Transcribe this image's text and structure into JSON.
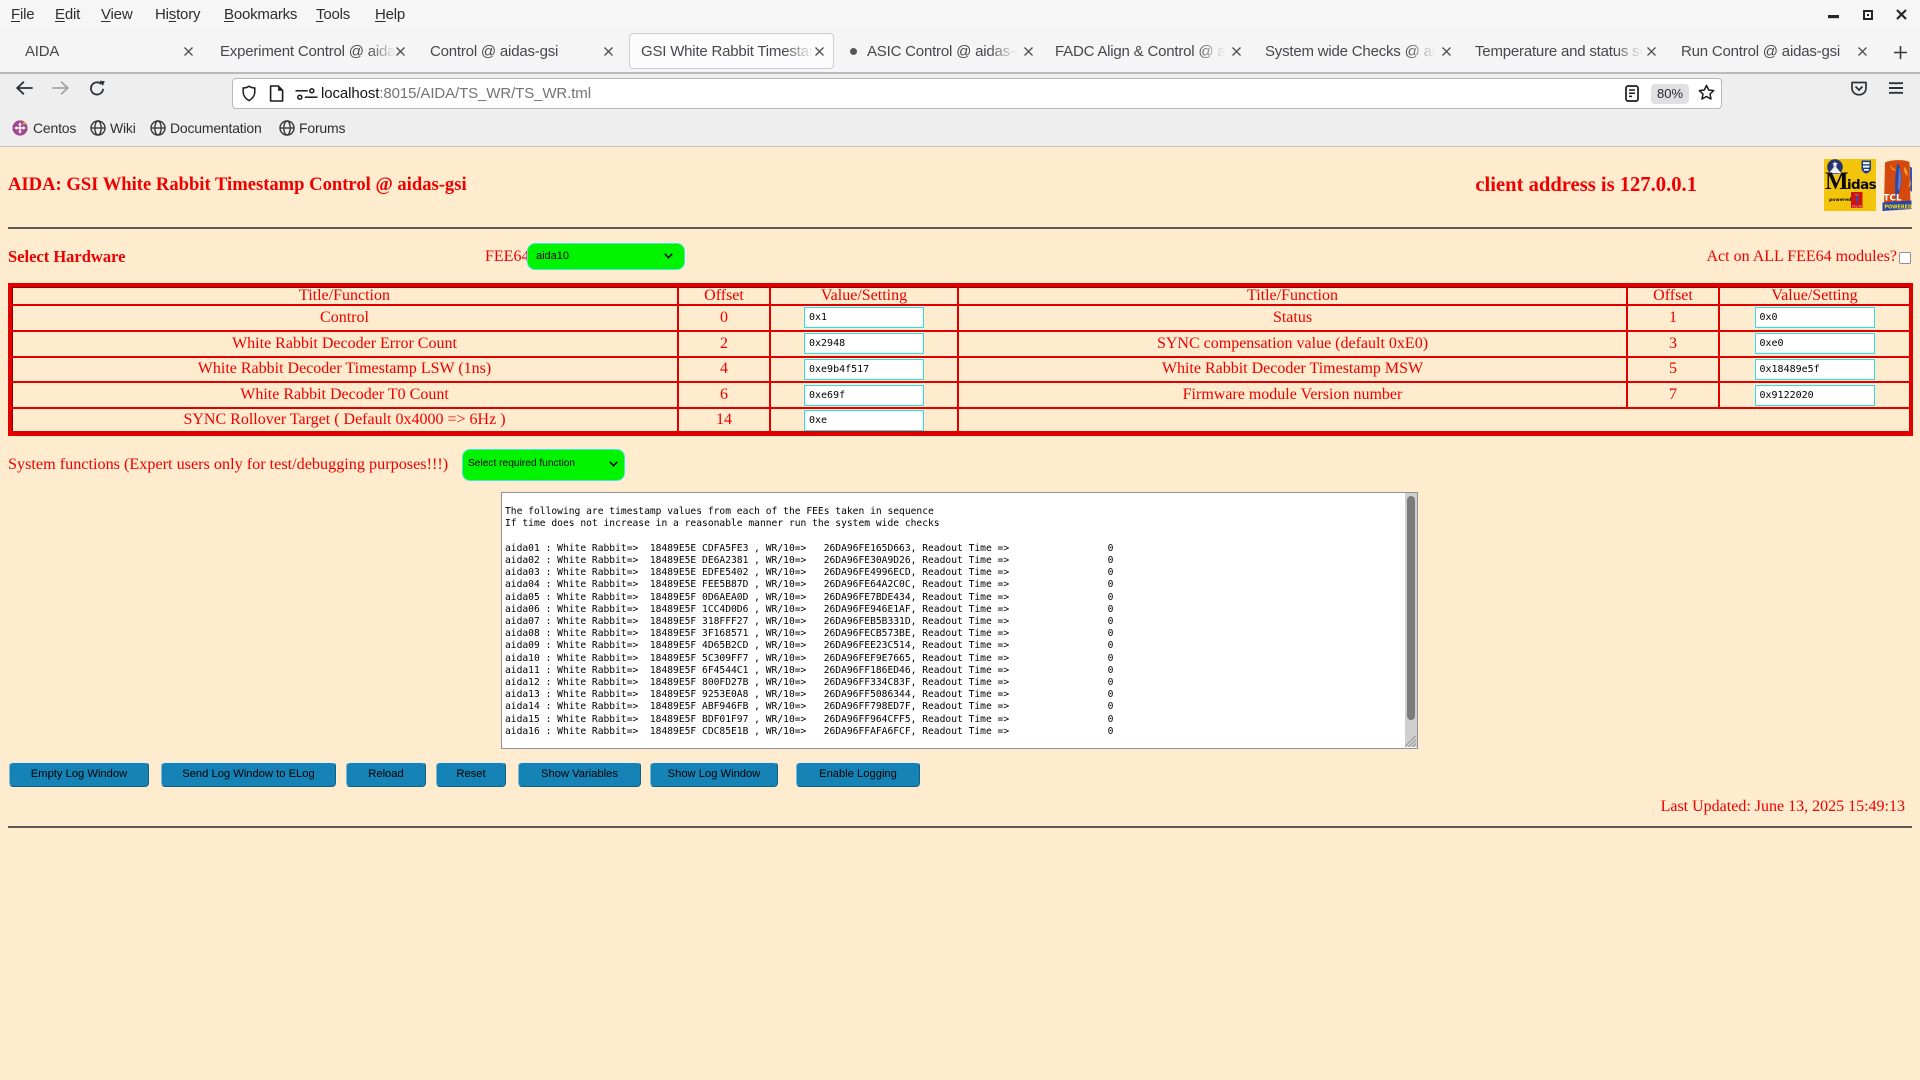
{
  "browser": {
    "menu": {
      "items": [
        "File",
        "Edit",
        "View",
        "History",
        "Bookmarks",
        "Tools",
        "Help"
      ]
    },
    "window_controls": [
      "minimize",
      "restore",
      "close"
    ],
    "tabs": [
      {
        "label": "AIDA",
        "active": false
      },
      {
        "label": "Experiment Control @ aidas",
        "active": false
      },
      {
        "label": "Control @ aidas-gsi",
        "active": false
      },
      {
        "label": "GSI White Rabbit Timestam",
        "active": true
      },
      {
        "label": "ASIC Control @ aidas-g",
        "active": false,
        "indicator_dot": true
      },
      {
        "label": "FADC Align & Control @ ai",
        "active": false
      },
      {
        "label": "System wide Checks @ aid",
        "active": false
      },
      {
        "label": "Temperature and status sc",
        "active": false
      },
      {
        "label": "Run Control @ aidas-gsi",
        "active": false
      }
    ],
    "new_tab_button": "+",
    "urlbar": {
      "host": "localhost",
      "rest": ":8015/AIDA/TS_WR/TS_WR.tml",
      "zoom_level": "80%"
    },
    "bookmarks": [
      {
        "label": "Centos",
        "icon": "centos"
      },
      {
        "label": "Wiki",
        "icon": "globe"
      },
      {
        "label": "Documentation",
        "icon": "globe"
      },
      {
        "label": "Forums",
        "icon": "globe"
      }
    ]
  },
  "page": {
    "title": "AIDA: GSI White Rabbit Timestamp Control @ aidas-gsi",
    "client_address": "client address is 127.0.0.1",
    "select_hardware_label": "Select Hardware",
    "fee64_label": "FEE64",
    "fee64_selected": "aida10",
    "act_on_all_label": "Act on ALL FEE64 modules?",
    "act_on_all_checked": false,
    "system_functions_label": "System functions (Expert users only for test/debugging purposes!!!)",
    "system_functions_selected": "Select required function",
    "last_updated": "Last Updated: June 13, 2025 15:49:13",
    "colors": {
      "background": "#FFEBCD",
      "text_red": "#ee0000",
      "table_border_red": "#e00000",
      "select_green": "#00ef00",
      "input_border_cyan": "#2ae0e8",
      "button_blue": "#1583b5"
    }
  },
  "table": {
    "headers": [
      "Title/Function",
      "Offset",
      "Value/Setting",
      "Title/Function",
      "Offset",
      "Value/Setting"
    ],
    "rows": [
      {
        "t1": "Control",
        "o1": "0",
        "v1": "0x1",
        "t2": "Status",
        "o2": "1",
        "v2": "0x0"
      },
      {
        "t1": "White Rabbit Decoder Error Count",
        "o1": "2",
        "v1": "0x2948",
        "t2": "SYNC compensation value (default 0xE0)",
        "o2": "3",
        "v2": "0xe0"
      },
      {
        "t1": "White Rabbit Decoder Timestamp LSW (1ns)",
        "o1": "4",
        "v1": "0xe9b4f517",
        "t2": "White Rabbit Decoder Timestamp MSW",
        "o2": "5",
        "v2": "0x18489e5f"
      },
      {
        "t1": "White Rabbit Decoder T0 Count",
        "o1": "6",
        "v1": "0xe69f",
        "t2": "Firmware module Version number",
        "o2": "7",
        "v2": "0x9122020"
      },
      {
        "t1": "SYNC Rollover Target ( Default 0x4000 => 6Hz )",
        "o1": "14",
        "v1": "0xe",
        "t2": "",
        "o2": "",
        "v2": ""
      }
    ]
  },
  "buttons": [
    {
      "label": "Empty Log Window"
    },
    {
      "label": "Send Log Window to ELog"
    },
    {
      "label": "Reload"
    },
    {
      "label": "Reset"
    },
    {
      "label": "Show Variables"
    },
    {
      "label": "Show Log Window"
    },
    {
      "label": "Enable Logging"
    }
  ],
  "log": {
    "text": "\nThe following are timestamp values from each of the FEEs taken in sequence\nIf time does not increase in a reasonable manner run the system wide checks\n\naida01 : White Rabbit=>  18489E5E CDFA5FE3 , WR/10=>   26DA96FE165D663, Readout Time =>                 0\naida02 : White Rabbit=>  18489E5E DE6A2381 , WR/10=>   26DA96FE30A9D26, Readout Time =>                 0\naida03 : White Rabbit=>  18489E5E EDFE5402 , WR/10=>   26DA96FE4996ECD, Readout Time =>                 0\naida04 : White Rabbit=>  18489E5E FEE5B87D , WR/10=>   26DA96FE64A2C0C, Readout Time =>                 0\naida05 : White Rabbit=>  18489E5F 0D6AEA0D , WR/10=>   26DA96FE7BDE434, Readout Time =>                 0\naida06 : White Rabbit=>  18489E5F 1CC4D0D6 , WR/10=>   26DA96FE946E1AF, Readout Time =>                 0\naida07 : White Rabbit=>  18489E5F 318FFF27 , WR/10=>   26DA96FEB5B331D, Readout Time =>                 0\naida08 : White Rabbit=>  18489E5F 3F168571 , WR/10=>   26DA96FECB573BE, Readout Time =>                 0\naida09 : White Rabbit=>  18489E5F 4D65B2CD , WR/10=>   26DA96FEE23C514, Readout Time =>                 0\naida10 : White Rabbit=>  18489E5F 5C309FF7 , WR/10=>   26DA96FEF9E7665, Readout Time =>                 0\naida11 : White Rabbit=>  18489E5F 6F4544C1 , WR/10=>   26DA96FF186ED46, Readout Time =>                 0\naida12 : White Rabbit=>  18489E5F 800FD27B , WR/10=>   26DA96FF334C83F, Readout Time =>                 0\naida13 : White Rabbit=>  18489E5F 9253E0A8 , WR/10=>   26DA96FF5086344, Readout Time =>                 0\naida14 : White Rabbit=>  18489E5F ABF946FB , WR/10=>   26DA96FF798ED7F, Readout Time =>                 0\naida15 : White Rabbit=>  18489E5F BDF01F97 , WR/10=>   26DA96FF964CFF5, Readout Time =>                 0\naida16 : White Rabbit=>  18489E5F CDC85E1B , WR/10=>   26DA96FFAFA6FCF, Readout Time =>                 0",
    "entries": [
      {
        "fee": "aida01",
        "wr": "18489E5E CDFA5FE3",
        "wr10": "26DA96FE165D663",
        "readout_time": "0"
      },
      {
        "fee": "aida02",
        "wr": "18489E5E DE6A2381",
        "wr10": "26DA96FE30A9D26",
        "readout_time": "0"
      },
      {
        "fee": "aida03",
        "wr": "18489E5E EDFE5402",
        "wr10": "26DA96FE4996ECD",
        "readout_time": "0"
      },
      {
        "fee": "aida04",
        "wr": "18489E5E FEE5B87D",
        "wr10": "26DA96FE64A2C0C",
        "readout_time": "0"
      },
      {
        "fee": "aida05",
        "wr": "18489E5F 0D6AEA0D",
        "wr10": "26DA96FE7BDE434",
        "readout_time": "0"
      },
      {
        "fee": "aida06",
        "wr": "18489E5F 1CC4D0D6",
        "wr10": "26DA96FE946E1AF",
        "readout_time": "0"
      },
      {
        "fee": "aida07",
        "wr": "18489E5F 318FFF27",
        "wr10": "26DA96FEB5B331D",
        "readout_time": "0"
      },
      {
        "fee": "aida08",
        "wr": "18489E5F 3F168571",
        "wr10": "26DA96FECB573BE",
        "readout_time": "0"
      },
      {
        "fee": "aida09",
        "wr": "18489E5F 4D65B2CD",
        "wr10": "26DA96FEE23C514",
        "readout_time": "0"
      },
      {
        "fee": "aida10",
        "wr": "18489E5F 5C309FF7",
        "wr10": "26DA96FEF9E7665",
        "readout_time": "0"
      },
      {
        "fee": "aida11",
        "wr": "18489E5F 6F4544C1",
        "wr10": "26DA96FF186ED46",
        "readout_time": "0"
      },
      {
        "fee": "aida12",
        "wr": "18489E5F 800FD27B",
        "wr10": "26DA96FF334C83F",
        "readout_time": "0"
      },
      {
        "fee": "aida13",
        "wr": "18489E5F 9253E0A8",
        "wr10": "26DA96FF5086344",
        "readout_time": "0"
      },
      {
        "fee": "aida14",
        "wr": "18489E5F ABF946FB",
        "wr10": "26DA96FF798ED7F",
        "readout_time": "0"
      },
      {
        "fee": "aida15",
        "wr": "18489E5F BDF01F97",
        "wr10": "26DA96FF964CFF5",
        "readout_time": "0"
      },
      {
        "fee": "aida16",
        "wr": "18489E5F CDC85E1B",
        "wr10": "26DA96FFAFA6FCF",
        "readout_time": "0"
      }
    ]
  }
}
